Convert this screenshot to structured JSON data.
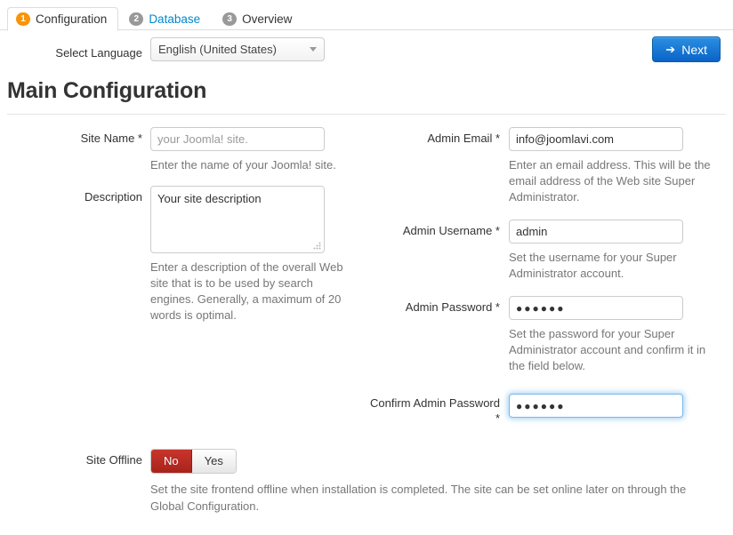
{
  "tabs": [
    {
      "num": "1",
      "label": "Configuration",
      "state": "active"
    },
    {
      "num": "2",
      "label": "Database",
      "state": "link"
    },
    {
      "num": "3",
      "label": "Overview",
      "state": "default"
    }
  ],
  "toolbar": {
    "language_label": "Select Language",
    "language_value": "English (United States)",
    "next_label": "Next",
    "next_arrow": "➔"
  },
  "heading": "Main Configuration",
  "left": {
    "site_name": {
      "label": "Site Name *",
      "value": "your Joomla! site.",
      "placeholder": "your Joomla! site.",
      "help": "Enter the name of your Joomla! site."
    },
    "description": {
      "label": "Description",
      "value": "Your site description",
      "help": "Enter a description of the overall Web site that is to be used by search engines. Generally, a maximum of 20 words is optimal."
    }
  },
  "right": {
    "admin_email": {
      "label": "Admin Email *",
      "value": "info@joomlavi.com",
      "help": "Enter an email address. This will be the email address of the Web site Super Administrator."
    },
    "admin_username": {
      "label": "Admin Username *",
      "value": "admin",
      "help": "Set the username for your Super Administrator account."
    },
    "admin_password": {
      "label": "Admin Password *",
      "value": "●●●●●●",
      "help": "Set the password for your Super Administrator account and confirm it in the field below."
    },
    "confirm_password": {
      "label": "Confirm Admin Password *",
      "value": "●●●●●●",
      "focused": true
    }
  },
  "site_offline": {
    "label": "Site Offline",
    "option_no": "No",
    "option_yes": "Yes",
    "selected": "No",
    "help": "Set the site frontend offline when installation is completed. The site can be set online later on through the Global Configuration."
  },
  "colors": {
    "badge_active": "#f89406",
    "badge_inactive": "#999999",
    "link": "#0088cc",
    "next_button": "#0a63c8",
    "danger": "#c9352c",
    "focus_ring": "#52a8ec"
  }
}
